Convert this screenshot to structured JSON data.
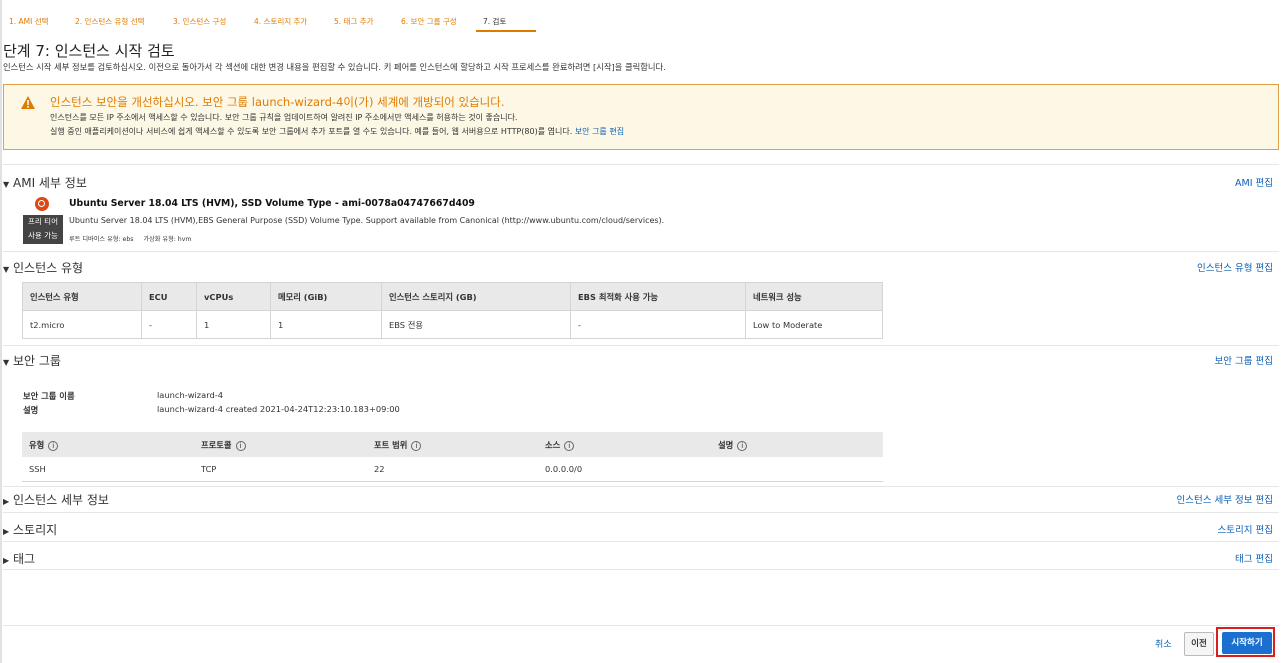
{
  "wizard": {
    "steps": [
      "1. AMI 선택",
      "2. 인스턴스 유형 선택",
      "3. 인스턴스 구성",
      "4. 스토리지 추가",
      "5. 태그 추가",
      "6. 보안 그룹 구성",
      "7. 검토"
    ],
    "active_step": 7
  },
  "page": {
    "title": "단계 7: 인스턴스 시작 검토",
    "description": "인스턴스 시작 세부 정보를 검토하십시오. 이전으로 돌아가서 각 섹션에 대한 변경 내용을 편집할 수 있습니다. 키 페어를 인스턴스에 할당하고 시작 프로세스를 완료하려면 [시작]을 클릭합니다."
  },
  "warning": {
    "title": "인스턴스 보안을 개선하십시오. 보안 그룹 launch-wizard-4이(가) 세계에 개방되어 있습니다.",
    "line1": "인스턴스를 모든 IP 주소에서 액세스할 수 있습니다. 보안 그룹 규칙을 업데이트하여 알려진 IP 주소에서만 액세스를 허용하는 것이 좋습니다.",
    "line2": "실행 중인 애플리케이션이나 서비스에 쉽게 액세스할 수 있도록 보안 그룹에서 추가 포트를 열 수도 있습니다. 예를 들어, 웹 서버용으로 HTTP(80)를 엽니다.",
    "link": "보안 그룹 편집",
    "accent_color": "#e07b00"
  },
  "ami": {
    "heading": "AMI 세부 정보",
    "edit": "AMI 편집",
    "name": "Ubuntu Server 18.04 LTS (HVM), SSD Volume Type - ami-0078a04747667d409",
    "description": "Ubuntu Server 18.04 LTS (HVM),EBS General Purpose (SSD) Volume Type. Support available from Canonical (http://www.ubuntu.com/cloud/services).",
    "free_tier_line1": "프리 티어",
    "free_tier_line2": "사용 가능",
    "root_device": "루트 디바이스 유형: ebs",
    "virtualization": "가상화 유형: hvm",
    "icon": "ubuntu-logo-icon"
  },
  "instance_type": {
    "heading": "인스턴스 유형",
    "edit": "인스턴스 유형 편집",
    "columns": [
      "인스턴스 유형",
      "ECU",
      "vCPUs",
      "메모리 (GiB)",
      "인스턴스 스토리지 (GB)",
      "EBS 최적화 사용 가능",
      "네트워크 성능"
    ],
    "row": [
      "t2.micro",
      "-",
      "1",
      "1",
      "EBS 전용",
      "-",
      "Low to Moderate"
    ]
  },
  "security_group": {
    "heading": "보안 그룹",
    "edit": "보안 그룹 편집",
    "name_label": "보안 그룹 이름",
    "name_value": "launch-wizard-4",
    "desc_label": "설명",
    "desc_value": "launch-wizard-4 created 2021-04-24T12:23:10.183+09:00",
    "columns": [
      "유형",
      "프로토콜",
      "포트 범위",
      "소스",
      "설명"
    ],
    "row": [
      "SSH",
      "TCP",
      "22",
      "0.0.0.0/0",
      ""
    ]
  },
  "instance_details": {
    "heading": "인스턴스 세부 정보",
    "edit": "인스턴스 세부 정보 편집"
  },
  "storage": {
    "heading": "스토리지",
    "edit": "스토리지 편집"
  },
  "tags": {
    "heading": "태그",
    "edit": "태그 편집"
  },
  "footer": {
    "cancel": "취소",
    "previous": "이전",
    "launch": "시작하기",
    "launch_color": "#1b6fce",
    "highlight_color": "#d81f1f"
  }
}
